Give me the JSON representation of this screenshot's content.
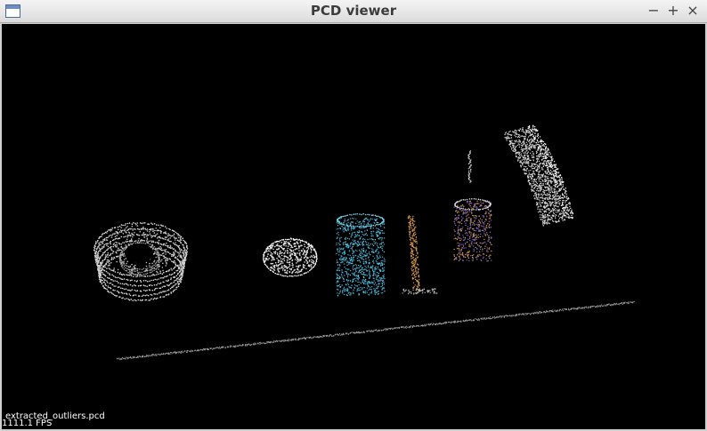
{
  "window": {
    "title": "PCD viewer",
    "controls": {
      "minimize": "−",
      "maximize": "+",
      "close": "×"
    }
  },
  "viewer": {
    "filename": "extracted_outliers.pcd",
    "fps": "1111.1 FPS",
    "background": "#000000"
  }
}
